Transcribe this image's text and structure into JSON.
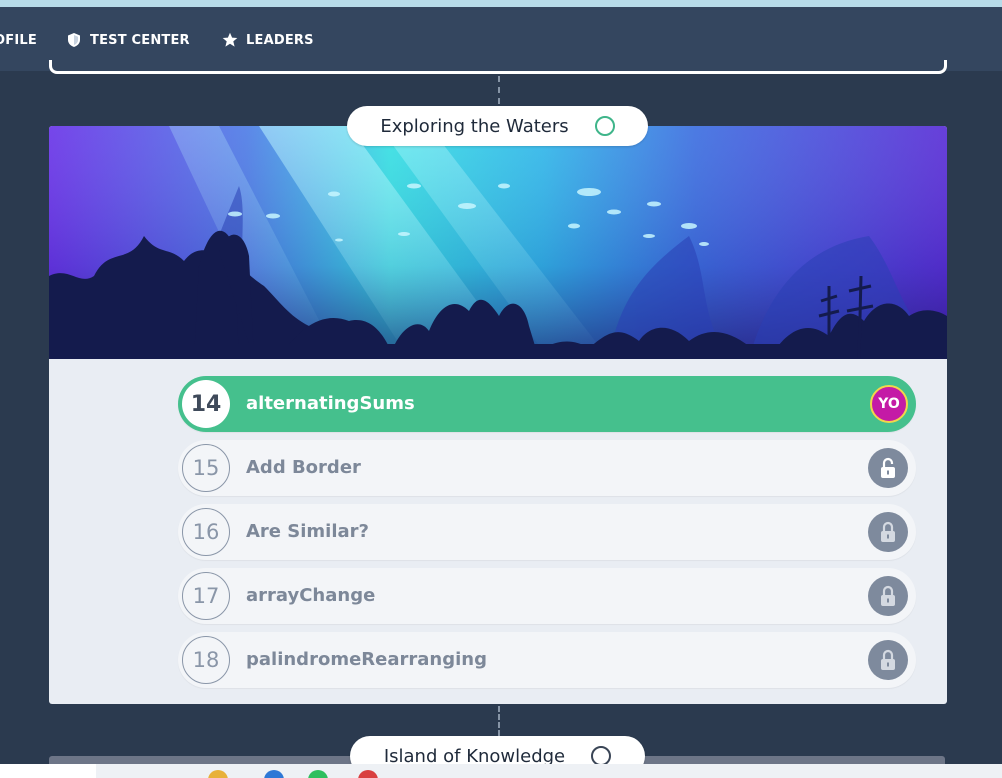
{
  "nav": {
    "items": [
      {
        "label": "OFILE",
        "icon": "user-icon"
      },
      {
        "label": "TEST CENTER",
        "icon": "shield-icon"
      },
      {
        "label": "LEADERS",
        "icon": "star-icon"
      }
    ]
  },
  "section": {
    "title": "Exploring the Waters",
    "status_icon": "circle-outline-icon",
    "tasks": [
      {
        "number": "14",
        "name": "alternatingSums",
        "state": "current",
        "badge": "YO"
      },
      {
        "number": "15",
        "name": "Add Border",
        "state": "unlocked",
        "icon": "lock-open-icon"
      },
      {
        "number": "16",
        "name": "Are Similar?",
        "state": "locked",
        "icon": "lock-icon"
      },
      {
        "number": "17",
        "name": "arrayChange",
        "state": "locked",
        "icon": "lock-icon"
      },
      {
        "number": "18",
        "name": "palindromeRearranging",
        "state": "locked",
        "icon": "lock-icon"
      }
    ]
  },
  "next_section": {
    "title": "Island of Knowledge",
    "status_icon": "circle-outline-icon"
  },
  "colors": {
    "navbar": "#34465f",
    "background": "#2b3a4f",
    "active_task": "#45c08d",
    "avatar": "#c41aa6",
    "lock": "#7e8a9d"
  }
}
